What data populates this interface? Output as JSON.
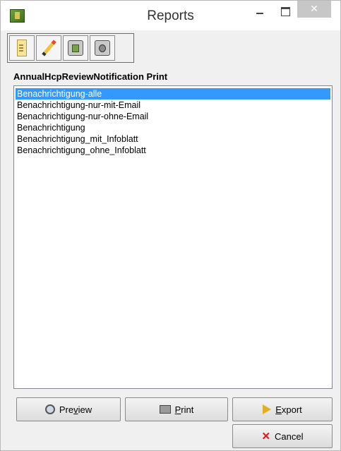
{
  "window": {
    "title": "Reports",
    "close_symbol": "✕"
  },
  "toolbar": {
    "buttons": [
      {
        "icon": "report-document-icon"
      },
      {
        "icon": "pencil-edit-icon"
      },
      {
        "icon": "library-add-icon"
      },
      {
        "icon": "library-remove-icon"
      }
    ]
  },
  "list": {
    "title": "AnnualHcpReviewNotification Print",
    "items": [
      {
        "label": "Benachrichtigung-alle",
        "selected": true
      },
      {
        "label": "Benachrichtigung-nur-mit-Email",
        "selected": false
      },
      {
        "label": "Benachrichtigung-nur-ohne-Email",
        "selected": false
      },
      {
        "label": "Benachrichtigung",
        "selected": false
      },
      {
        "label": "Benachrichtigung_mit_Infoblatt",
        "selected": false
      },
      {
        "label": "Benachrichtigung_ohne_Infoblatt",
        "selected": false
      }
    ]
  },
  "buttons": {
    "preview": {
      "label_pre": "Pre",
      "label_u": "v",
      "label_post": "iew",
      "icon": "preview-icon"
    },
    "print": {
      "label_pre": "",
      "label_u": "P",
      "label_post": "rint",
      "icon": "printer-icon"
    },
    "export": {
      "label_pre": "",
      "label_u": "E",
      "label_post": "xport",
      "icon": "export-icon"
    },
    "cancel": {
      "label": "Cancel",
      "icon": "cancel-x-icon",
      "icon_glyph": "✕"
    }
  },
  "colors": {
    "selection": "#3399ff",
    "cancel_icon": "#d42020"
  }
}
